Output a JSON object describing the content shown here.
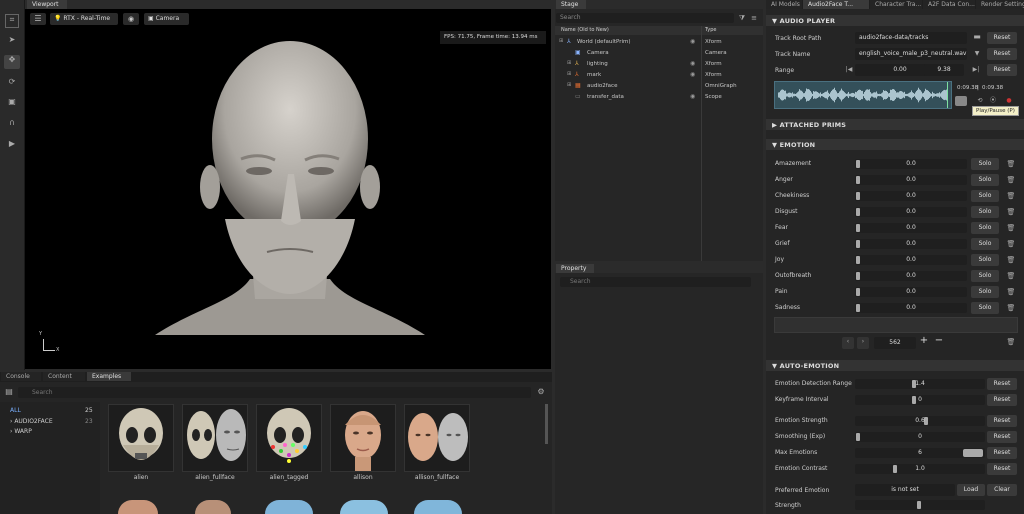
{
  "left_toolbar": {
    "icons": [
      "select-icon",
      "pointer-icon",
      "move-icon",
      "rotate-icon",
      "scale-icon",
      "snap-icon",
      "play-icon"
    ]
  },
  "viewport": {
    "tab": "Viewport",
    "renderer": "RTX - Real-Time",
    "camera": "Camera",
    "fps": "FPS: 71.75, Frame time: 13.94 ms",
    "axis_y": "Y",
    "axis_x": "X"
  },
  "stage": {
    "tab": "Stage",
    "search_placeholder": "Search",
    "col_name": "Name (Old to New)",
    "col_type": "Type",
    "rows": [
      {
        "name": "World (defaultPrim)",
        "type": "Xform",
        "indent": 0
      },
      {
        "name": "Camera",
        "type": "Camera",
        "indent": 1
      },
      {
        "name": "lighting",
        "type": "Xform",
        "indent": 1
      },
      {
        "name": "mark",
        "type": "Xform",
        "indent": 1
      },
      {
        "name": "audio2face",
        "type": "OmniGraph",
        "indent": 1
      },
      {
        "name": "transfer_data",
        "type": "Scope",
        "indent": 1
      }
    ]
  },
  "property": {
    "tab": "Property",
    "search_placeholder": "Search"
  },
  "bottom": {
    "tabs": [
      "Console",
      "Content",
      "Examples"
    ],
    "search_placeholder": "Search",
    "categories": [
      {
        "name": "ALL",
        "count": "25"
      },
      {
        "name": "AUDIO2FACE",
        "count": "23"
      },
      {
        "name": "WARP",
        "count": ""
      }
    ],
    "thumbs": [
      "alien",
      "alien_fullface",
      "alien_tagged",
      "allison",
      "allison_fullface"
    ]
  },
  "right": {
    "tabs": [
      "AI Models",
      "Audio2Face T...",
      "Character Tra...",
      "A2F Data Con...",
      "Render Settings"
    ],
    "audio_player": {
      "header": "AUDIO PLAYER",
      "track_root_label": "Track Root Path",
      "track_root_value": "audio2face-data/tracks",
      "track_name_label": "Track Name",
      "track_name_value": "english_voice_male_p3_neutral.wav",
      "range_label": "Range",
      "range_start": "0.00",
      "range_end": "9.38",
      "time_current": "0:09.38",
      "time_total": "0:09.38",
      "tooltip": "Play/Pause (P)",
      "reset": "Reset"
    },
    "attached_prims": "ATTACHED PRIMS",
    "emotion": {
      "header": "EMOTION",
      "rows": [
        {
          "name": "Amazement",
          "value": "0.0"
        },
        {
          "name": "Anger",
          "value": "0.0"
        },
        {
          "name": "Cheekiness",
          "value": "0.0"
        },
        {
          "name": "Disgust",
          "value": "0.0"
        },
        {
          "name": "Fear",
          "value": "0.0"
        },
        {
          "name": "Grief",
          "value": "0.0"
        },
        {
          "name": "Joy",
          "value": "0.0"
        },
        {
          "name": "Outofbreath",
          "value": "0.0"
        },
        {
          "name": "Pain",
          "value": "0.0"
        },
        {
          "name": "Sadness",
          "value": "0.0"
        }
      ],
      "solo": "Solo",
      "frame": "562"
    },
    "auto_emotion": {
      "header": "AUTO-EMOTION",
      "rows": [
        {
          "name": "Emotion Detection Range",
          "value": "1.4",
          "level": 0.45
        },
        {
          "name": "Keyframe Interval",
          "value": "0",
          "level": 0.45
        },
        {
          "name": "Emotion Strength",
          "value": "0.6",
          "level": 0.55
        },
        {
          "name": "Smoothing (Exp)",
          "value": "0",
          "level": 0.0
        },
        {
          "name": "Max Emotions",
          "value": "6",
          "level": 1.0
        },
        {
          "name": "Emotion Contrast",
          "value": "1.0",
          "level": 0.3
        }
      ],
      "reset": "Reset",
      "preferred_label": "Preferred Emotion",
      "preferred_value": "is not set",
      "load": "Load",
      "clear": "Clear",
      "strength_label": "Strength"
    }
  }
}
